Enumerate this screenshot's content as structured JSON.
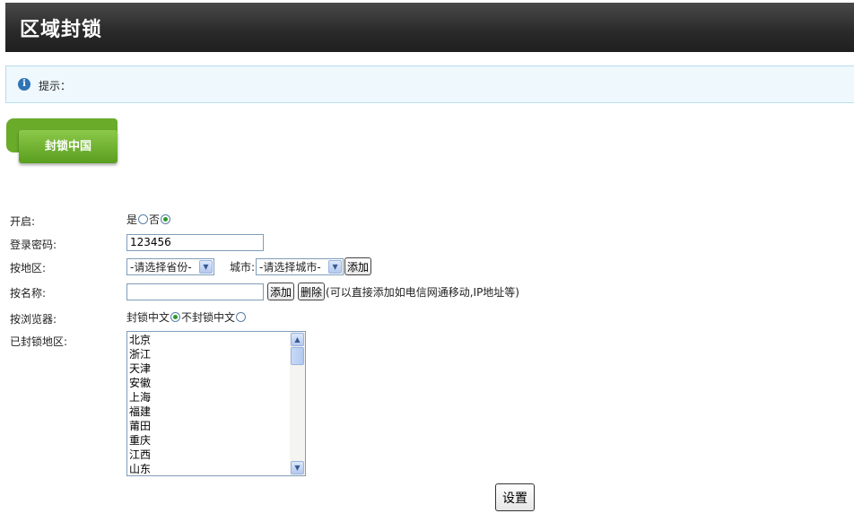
{
  "header": {
    "title": "区域封锁"
  },
  "tip": {
    "text": "提示：",
    "icon": "info-icon"
  },
  "tab": {
    "label": "封锁中国"
  },
  "form": {
    "enable": {
      "label": "开启:",
      "yes": "是",
      "no": "否",
      "selected": "no"
    },
    "password": {
      "label": "登录密码:",
      "value": "123456"
    },
    "region": {
      "label": "按地区:",
      "province_selected": "-请选择省份-",
      "city_label": "城市:",
      "city_selected": "-请选择城市-",
      "add_button": "添加"
    },
    "name": {
      "label": "按名称:",
      "value": "",
      "add_button": "添加",
      "delete_button": "删除",
      "hint": "(可以直接添加如电信网通移动,IP地址等)"
    },
    "browser": {
      "label": "按浏览器:",
      "block_cn": "封锁中文",
      "no_block_cn": "不封锁中文",
      "selected": "block_cn"
    },
    "blocked": {
      "label": "已封锁地区:",
      "items": [
        "北京",
        "浙江",
        "天津",
        "安徽",
        "上海",
        "福建",
        "莆田",
        "重庆",
        "江西",
        "山东"
      ]
    },
    "submit_button": "设置"
  },
  "colors": {
    "accent_green": "#6aab2a",
    "header_bg": "#2b2b2b",
    "tip_bg": "#eef8fd"
  }
}
